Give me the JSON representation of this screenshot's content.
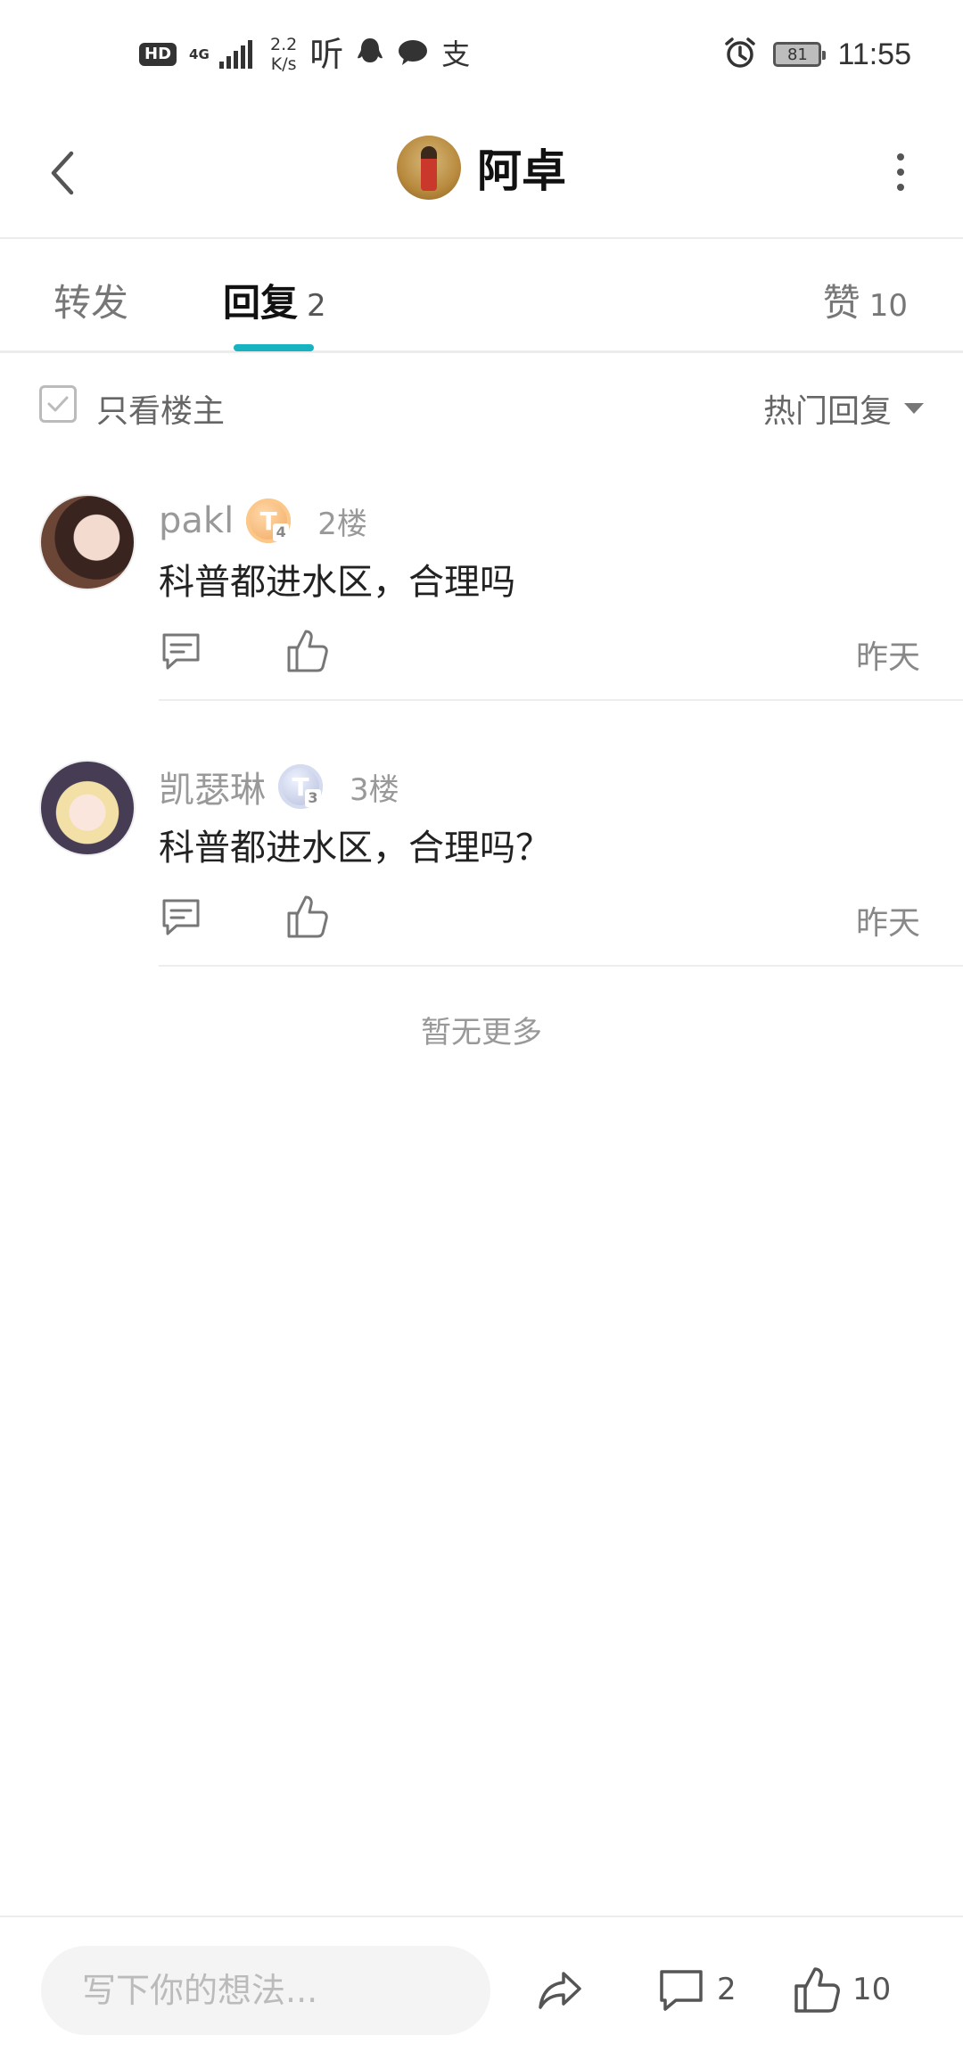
{
  "status_bar": {
    "hd": "HD",
    "network": "4G",
    "speed_value": "2.2",
    "speed_unit": "K/s",
    "icons": [
      "ting-icon",
      "qq-icon",
      "wechat-icon",
      "alipay-icon"
    ],
    "ting_glyph": "听",
    "alipay_glyph": "支",
    "battery": "81",
    "time": "11:55"
  },
  "header": {
    "title": "阿卓"
  },
  "tabs": {
    "forward_label": "转发",
    "reply_label": "回复",
    "reply_count": "2",
    "like_label": "赞",
    "like_count": "10",
    "active": "reply",
    "accent_color": "#17b3c1"
  },
  "filter": {
    "only_op_label": "只看楼主",
    "sort_label": "热门回复"
  },
  "replies": [
    {
      "name": "pakl",
      "level": "T",
      "level_sub": "4",
      "floor": "2楼",
      "text": "科普都进水区，合理吗",
      "time": "昨天"
    },
    {
      "name": "凯瑟琳",
      "level": "T",
      "level_sub": "3",
      "floor": "3楼",
      "text": "科普都进水区，合理吗？",
      "time": "昨天"
    }
  ],
  "footer_note": "暂无更多",
  "bottom_bar": {
    "input_placeholder": "写下你的想法...",
    "comment_count": "2",
    "like_count": "10"
  }
}
